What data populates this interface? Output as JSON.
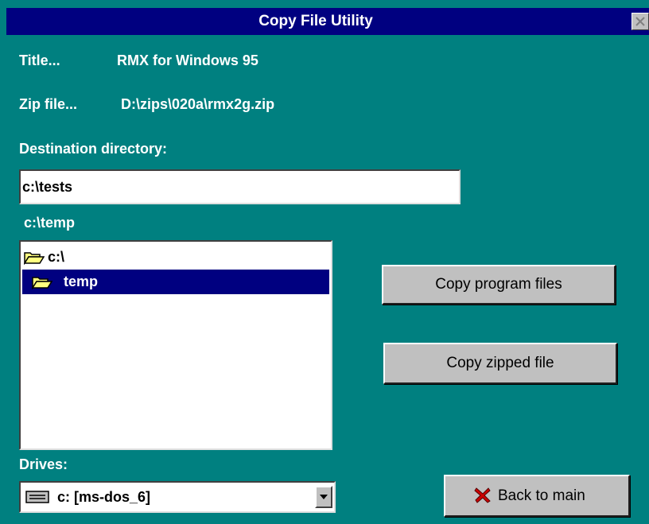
{
  "window": {
    "title": "Copy File Utility"
  },
  "info": {
    "title_label": "Title...",
    "title_value": "RMX for Windows 95",
    "zip_label": "Zip file...",
    "zip_value": "D:\\zips\\020a\\rmx2g.zip"
  },
  "destination": {
    "label": "Destination directory:",
    "value": "c:\\tests"
  },
  "current_dir": "c:\\temp",
  "directory_list": {
    "items": [
      {
        "label": "c:\\",
        "icon": "open-folder-icon",
        "selected": false
      },
      {
        "label": "temp",
        "icon": "open-folder-icon",
        "selected": true
      }
    ]
  },
  "drives": {
    "label": "Drives:",
    "value": "c: [ms-dos_6]",
    "icon": "hard-drive-icon"
  },
  "buttons": {
    "copy_program_files": "Copy program files",
    "copy_zipped_file": "Copy zipped file",
    "back_to_main": "Back to main"
  },
  "colors": {
    "background": "#008080",
    "titlebar": "#000080",
    "selection": "#000080",
    "button_face": "#c0c0c0",
    "close_x_icon": "#cc0000"
  }
}
